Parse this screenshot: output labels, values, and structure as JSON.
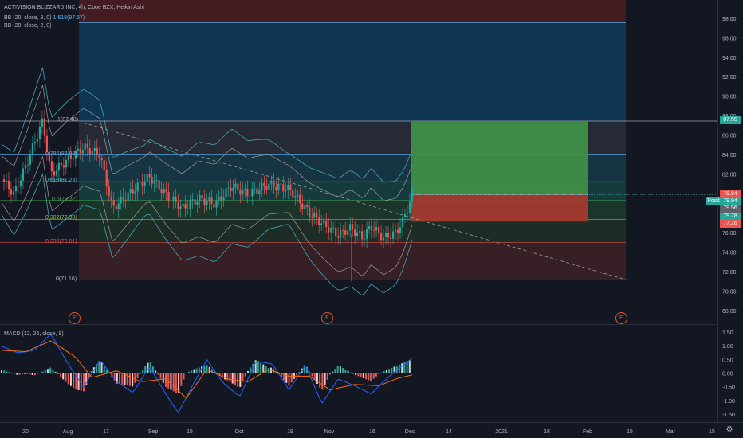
{
  "header": {
    "symbol_line": "ACTIVISION BLIZZARD INC, 4h, Cboe BZX, Heikin Ashi",
    "bb1": "BB (20, close, 3, 0)",
    "bb1_extra": "1.618(97.57)",
    "bb2": "BB (20, close, 2, 0)",
    "macd": "MACD (12, 26, close, 9)"
  },
  "fib_levels": [
    {
      "label": "1(87.48)",
      "price": 87.48,
      "color": "#b2b5be"
    },
    {
      "label": "0.786(83.98)",
      "price": 84.0,
      "color": "#5ab0f0"
    },
    {
      "label": "0.618(81.25)",
      "price": 81.25,
      "color": "#4dd0e1"
    },
    {
      "label": "0.5(79.32)",
      "price": 79.32,
      "color": "#4caf50"
    },
    {
      "label": "0.382(77.39)",
      "price": 77.39,
      "color": "#8bc34a"
    },
    {
      "label": "0.236(75.01)",
      "price": 75.01,
      "color": "#ef5350"
    },
    {
      "label": "0(71.16)",
      "price": 71.16,
      "color": "#b2b5be"
    }
  ],
  "price_tags": [
    {
      "text": "87.55",
      "price": 87.55,
      "color": "#26a69a"
    },
    {
      "text": "79.94",
      "price": 79.94,
      "color": "#ef5350"
    },
    {
      "text": "79.94",
      "price": 79.2,
      "color": "#26a69a"
    },
    {
      "text": "79.56",
      "price": 78.45,
      "color": "#5d606b"
    },
    {
      "text": "79.78",
      "price": 77.7,
      "color": "#26a69a"
    },
    {
      "text": "77.16",
      "price": 76.95,
      "color": "#ef5350"
    }
  ],
  "position_label": "Posit",
  "earnings_marker": "E",
  "gear_icon": "gear-icon",
  "chart_data": [
    {
      "type": "candlestick",
      "title": "ACTIVISION BLIZZARD INC, 4h, Cboe BZX, Heikin Ashi",
      "yticks": [
        68.0,
        70.0,
        72.0,
        74.0,
        76.0,
        78.0,
        80.0,
        82.0,
        84.0,
        86.0,
        88.0,
        90.0,
        92.0,
        94.0,
        96.0,
        98.0
      ],
      "ylim": [
        66.8,
        99.5
      ],
      "x_ticks": [
        "20",
        "Aug",
        "17",
        "Sep",
        "15",
        "Oct",
        "19",
        "Nov",
        "16",
        "Dec",
        "14",
        "2021",
        "18",
        "Feb",
        "15",
        "Mar",
        "15"
      ],
      "price_path": [
        [
          0,
          81.5
        ],
        [
          0.03,
          80.0
        ],
        [
          0.06,
          83.0
        ],
        [
          0.1,
          87.5
        ],
        [
          0.12,
          82.0
        ],
        [
          0.16,
          83.5
        ],
        [
          0.2,
          84.8
        ],
        [
          0.24,
          84.0
        ],
        [
          0.27,
          78.5
        ],
        [
          0.31,
          80.0
        ],
        [
          0.36,
          81.8
        ],
        [
          0.4,
          80.0
        ],
        [
          0.44,
          78.5
        ],
        [
          0.48,
          79.5
        ],
        [
          0.52,
          79.0
        ],
        [
          0.56,
          80.8
        ],
        [
          0.6,
          80.0
        ],
        [
          0.65,
          81.0
        ],
        [
          0.7,
          80.5
        ],
        [
          0.75,
          78.0
        ],
        [
          0.78,
          77.0
        ],
        [
          0.82,
          75.8
        ],
        [
          0.85,
          76.5
        ],
        [
          0.88,
          75.5
        ],
        [
          0.9,
          76.7
        ],
        [
          0.93,
          75.5
        ],
        [
          0.96,
          76.0
        ],
        [
          0.98,
          77.5
        ],
        [
          1.0,
          79.9
        ]
      ],
      "macd_yticks": [
        -1.5,
        -1.0,
        -0.5,
        0.0,
        0.5,
        1.0,
        1.5
      ],
      "macd_ylim": [
        -1.72,
        1.72
      ],
      "macd_path": [
        [
          0,
          1.0
        ],
        [
          0.04,
          0.75
        ],
        [
          0.08,
          0.85
        ],
        [
          0.12,
          1.45
        ],
        [
          0.16,
          0.4
        ],
        [
          0.2,
          -0.5
        ],
        [
          0.24,
          0.5
        ],
        [
          0.28,
          -0.3
        ],
        [
          0.32,
          -0.7
        ],
        [
          0.36,
          0.25
        ],
        [
          0.4,
          -0.75
        ],
        [
          0.43,
          -1.45
        ],
        [
          0.47,
          -0.3
        ],
        [
          0.5,
          0.5
        ],
        [
          0.54,
          -0.35
        ],
        [
          0.58,
          -0.85
        ],
        [
          0.62,
          0.45
        ],
        [
          0.66,
          0.35
        ],
        [
          0.7,
          -0.6
        ],
        [
          0.74,
          0.3
        ],
        [
          0.78,
          -1.1
        ],
        [
          0.82,
          -0.2
        ],
        [
          0.86,
          -0.45
        ],
        [
          0.9,
          -0.75
        ],
        [
          0.93,
          -0.3
        ],
        [
          0.96,
          0.1
        ],
        [
          1.0,
          0.55
        ]
      ],
      "signal_path": [
        [
          0,
          0.85
        ],
        [
          0.06,
          0.8
        ],
        [
          0.12,
          1.2
        ],
        [
          0.18,
          0.6
        ],
        [
          0.22,
          -0.15
        ],
        [
          0.28,
          0.1
        ],
        [
          0.34,
          -0.3
        ],
        [
          0.4,
          -0.2
        ],
        [
          0.45,
          -0.9
        ],
        [
          0.5,
          0.15
        ],
        [
          0.55,
          -0.2
        ],
        [
          0.6,
          -0.3
        ],
        [
          0.65,
          0.15
        ],
        [
          0.7,
          -0.1
        ],
        [
          0.75,
          -0.1
        ],
        [
          0.8,
          -0.6
        ],
        [
          0.86,
          -0.4
        ],
        [
          0.92,
          -0.45
        ],
        [
          0.96,
          -0.2
        ],
        [
          1.0,
          -0.05
        ]
      ]
    }
  ]
}
